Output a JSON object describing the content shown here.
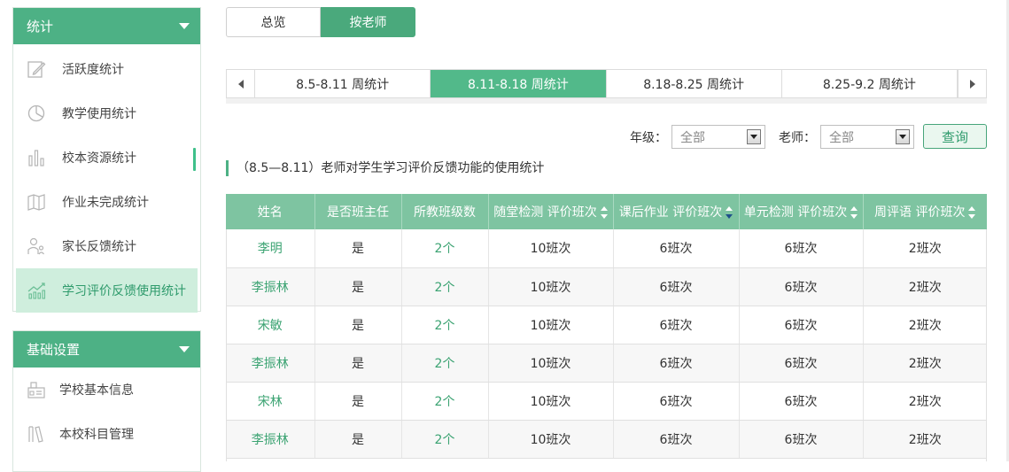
{
  "sidebar": {
    "stats": {
      "title": "统计",
      "items": [
        {
          "label": "活跃度统计",
          "icon": "edit-icon"
        },
        {
          "label": "教学使用统计",
          "icon": "pie-chart-icon"
        },
        {
          "label": "校本资源统计",
          "icon": "bar-chart-icon"
        },
        {
          "label": "作业未完成统计",
          "icon": "map-icon"
        },
        {
          "label": "家长反馈统计",
          "icon": "parent-icon"
        },
        {
          "label": "学习评价反馈使用统计",
          "icon": "line-chart-icon",
          "active": true
        }
      ]
    },
    "settings": {
      "title": "基础设置",
      "items": [
        {
          "label": "学校基本信息",
          "icon": "school-icon"
        },
        {
          "label": "本校科目管理",
          "icon": "books-icon"
        }
      ]
    }
  },
  "toggle": {
    "overview": "总览",
    "by_teacher": "按老师"
  },
  "weeks": [
    "8.5-8.11 周统计",
    "8.11-8.18 周统计",
    "8.18-8.25 周统计",
    "8.25-9.2 周统计"
  ],
  "active_week": 1,
  "filters": {
    "grade_label": "年级：",
    "grade_value": "全部",
    "teacher_label": "老师：",
    "teacher_value": "全部",
    "query": "查询"
  },
  "section_title": "（8.5—8.11）老师对学生学习评价反馈功能的使用统计",
  "table": {
    "headers": [
      "姓名",
      "是否班主任",
      "所教班级数",
      "随堂检测 评价班次",
      "课后作业 评价班次",
      "单元检测 评价班次",
      "周评语 评价班次"
    ],
    "rows": [
      [
        "李明",
        "是",
        "2个",
        "10班次",
        "6班次",
        "6班次",
        "2班次"
      ],
      [
        "李振林",
        "是",
        "2个",
        "10班次",
        "6班次",
        "6班次",
        "2班次"
      ],
      [
        "宋敏",
        "是",
        "2个",
        "10班次",
        "6班次",
        "6班次",
        "2班次"
      ],
      [
        "李振林",
        "是",
        "2个",
        "10班次",
        "6班次",
        "6班次",
        "2班次"
      ],
      [
        "宋林",
        "是",
        "2个",
        "10班次",
        "6班次",
        "6班次",
        "2班次"
      ],
      [
        "李振林",
        "是",
        "2个",
        "10班次",
        "6班次",
        "6班次",
        "2班次"
      ]
    ]
  },
  "colors": {
    "accent": "#4db185",
    "header": "#7ec4a1",
    "link": "#3ba372"
  }
}
